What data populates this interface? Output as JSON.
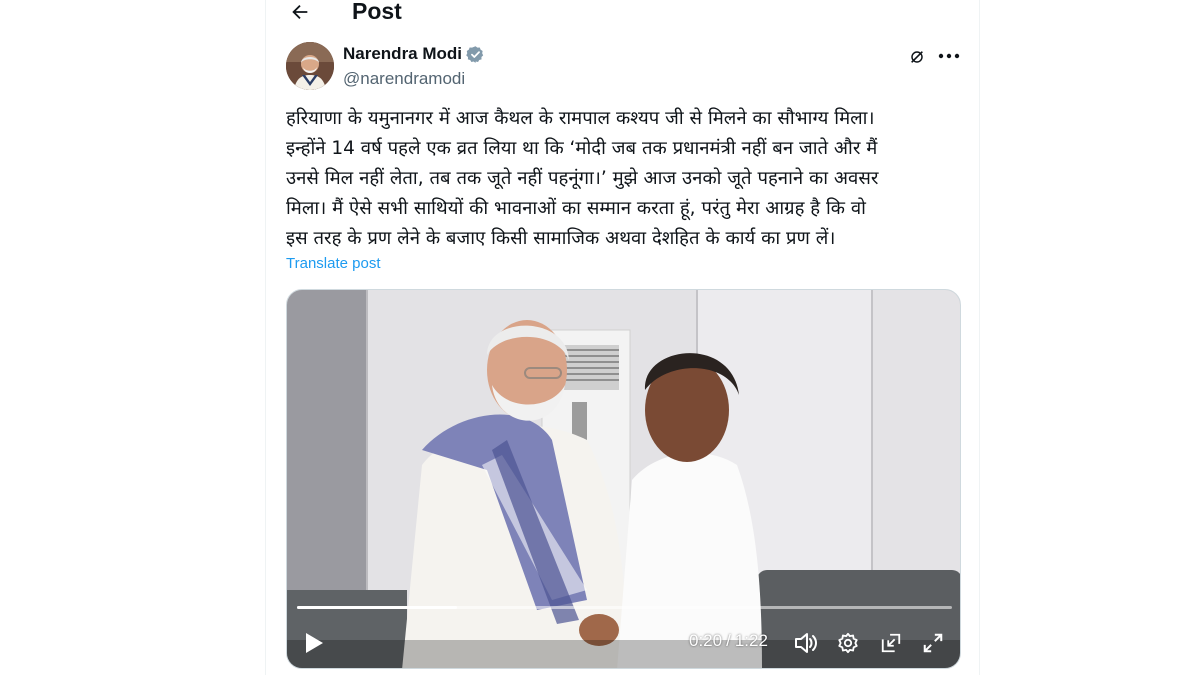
{
  "header": {
    "title": "Post"
  },
  "author": {
    "name": "Narendra Modi",
    "handle": "@narendramodi"
  },
  "post": {
    "text": "हरियाणा के यमुनानगर में आज कैथल के रामपाल कश्यप जी से मिलने का सौभाग्य मिला।\nइन्होंने 14 वर्ष पहले एक व्रत लिया था कि ‘मोदी जब तक प्रधानमंत्री नहीं बन जाते और मैं\nउनसे मिल नहीं लेता, तब तक जूते नहीं पहनूंगा।’ मुझे आज उनको जूते पहनाने का अवसर\nमिला। मैं ऐसे सभी साथियों की भावनाओं का सम्मान करता हूं, परंतु मेरा आग्रह है कि वो\nइस तरह के प्रण लेने के बजाए किसी सामाजिक अथवा देशहित के कार्य का प्रण लें।",
    "translate_label": "Translate post"
  },
  "video": {
    "current_time": "0:20",
    "separator": "/",
    "duration": "1:22",
    "progress": 0.244
  },
  "icons": {
    "back": "arrow-left-icon",
    "verified": "verified-badge-icon",
    "grok": "grok-icon",
    "more": "more-horizontal-icon",
    "play": "play-icon",
    "volume": "volume-icon",
    "settings": "gear-icon",
    "pip": "picture-in-picture-icon",
    "fullscreen": "fullscreen-icon"
  },
  "colors": {
    "accent": "#1d9bf0",
    "text": "#0f1419",
    "secondary": "#536471"
  }
}
